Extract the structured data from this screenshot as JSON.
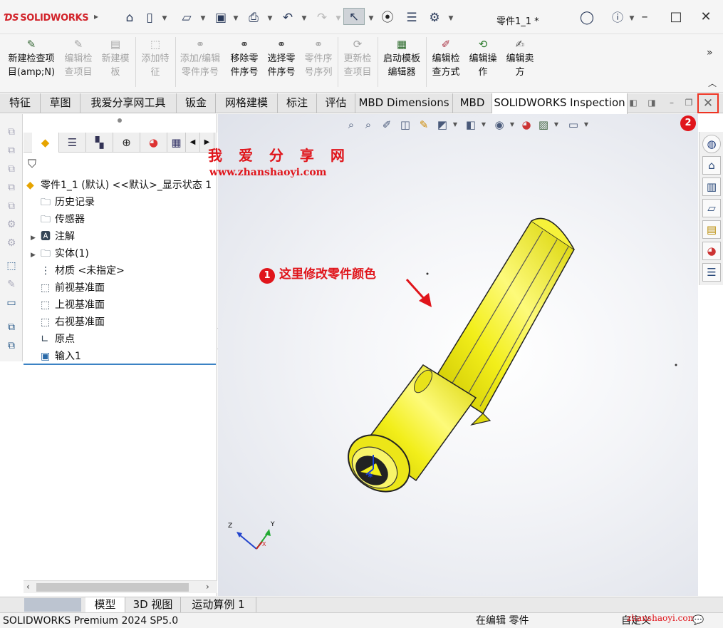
{
  "app": {
    "brand": "SOLIDWORKS",
    "document_title": "零件1_1 *"
  },
  "ribbon": {
    "items": [
      {
        "label1": "新建检查项",
        "label2": "目(amp;N)",
        "enabled": true
      },
      {
        "label1": "编辑检",
        "label2": "查项目",
        "enabled": false
      },
      {
        "label1": "新建模",
        "label2": "板",
        "enabled": false
      },
      {
        "label1": "添加特",
        "label2": "征",
        "enabled": false
      },
      {
        "label1": "添加/编辑",
        "label2": "零件序号",
        "enabled": false
      },
      {
        "label1": "移除零",
        "label2": "件序号",
        "enabled": true
      },
      {
        "label1": "选择零",
        "label2": "件序号",
        "enabled": true
      },
      {
        "label1": "零件序",
        "label2": "号序列",
        "enabled": false
      },
      {
        "label1": "更新检",
        "label2": "查项目",
        "enabled": false
      },
      {
        "label1": "启动模板",
        "label2": "编辑器",
        "enabled": true
      },
      {
        "label1": "编辑检",
        "label2": "查方式",
        "enabled": true
      },
      {
        "label1": "编辑操",
        "label2": "作",
        "enabled": true
      },
      {
        "label1": "编辑卖",
        "label2": "方",
        "enabled": true
      }
    ]
  },
  "tabs": [
    "特征",
    "草图",
    "我爱分享网工具",
    "钣金",
    "网格建模",
    "标注",
    "评估",
    "MBD Dimensions",
    "MBD",
    "SOLIDWORKS Inspection"
  ],
  "active_tab": "SOLIDWORKS Inspection",
  "tree": {
    "root": "零件1_1 (默认) <<默认>_显示状态 1",
    "items": [
      "历史记录",
      "传感器",
      "注解",
      "实体(1)",
      "材质 <未指定>",
      "前视基准面",
      "上视基准面",
      "右视基准面",
      "原点",
      "输入1"
    ]
  },
  "annotations": {
    "watermark_cn": "我 爱 分 享 网",
    "watermark_url": "www.zhanshaoyi.com",
    "callout1_num": "1",
    "callout1_text": "这里修改零件颜色",
    "callout2_num": "2"
  },
  "triad": {
    "x": "X",
    "y": "Y",
    "z": "Z"
  },
  "bottom_tabs": [
    "模型",
    "3D 视图",
    "运动算例 1"
  ],
  "status": {
    "version": "SOLIDWORKS Premium 2024 SP5.0",
    "mode": "在编辑 零件",
    "units": "自定义",
    "watermark": "zhanshaoyi.com"
  },
  "colors": {
    "part": "#f2ee1a",
    "accent": "#e0151b",
    "brand": "#d2232a"
  }
}
